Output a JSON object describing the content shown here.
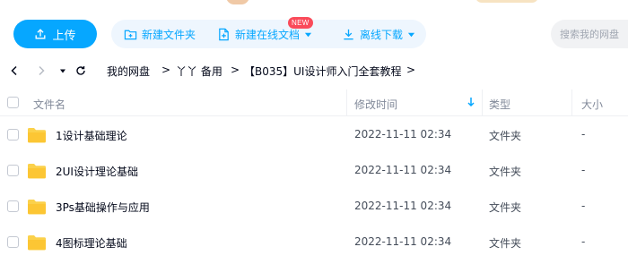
{
  "toolbar": {
    "upload_label": "上传",
    "new_folder_label": "新建文件夹",
    "new_online_doc_label": "新建在线文档",
    "new_badge": "NEW",
    "offline_download_label": "离线下载",
    "search_placeholder": "搜索我的网盘"
  },
  "breadcrumb": {
    "items": [
      "我的网盘",
      "丫丫 备用",
      "【B035】UI设计师入门全套教程"
    ],
    "separator": ">"
  },
  "table": {
    "columns": [
      "文件名",
      "修改时间",
      "类型",
      "大小"
    ],
    "rows": [
      {
        "name": "1设计基础理论",
        "modified": "2022-11-11 02:34",
        "type": "文件夹",
        "size": "-"
      },
      {
        "name": "2UI设计理论基础",
        "modified": "2022-11-11 02:34",
        "type": "文件夹",
        "size": "-"
      },
      {
        "name": "3Ps基础操作与应用",
        "modified": "2022-11-11 02:34",
        "type": "文件夹",
        "size": "-"
      },
      {
        "name": "4图标理论基础",
        "modified": "2022-11-11 02:34",
        "type": "文件夹",
        "size": "-"
      }
    ]
  },
  "colors": {
    "accent": "#06a7ff",
    "accent_light": "#eef6fe",
    "badge": "#fa4b5a",
    "folder": "#fbd14b"
  }
}
